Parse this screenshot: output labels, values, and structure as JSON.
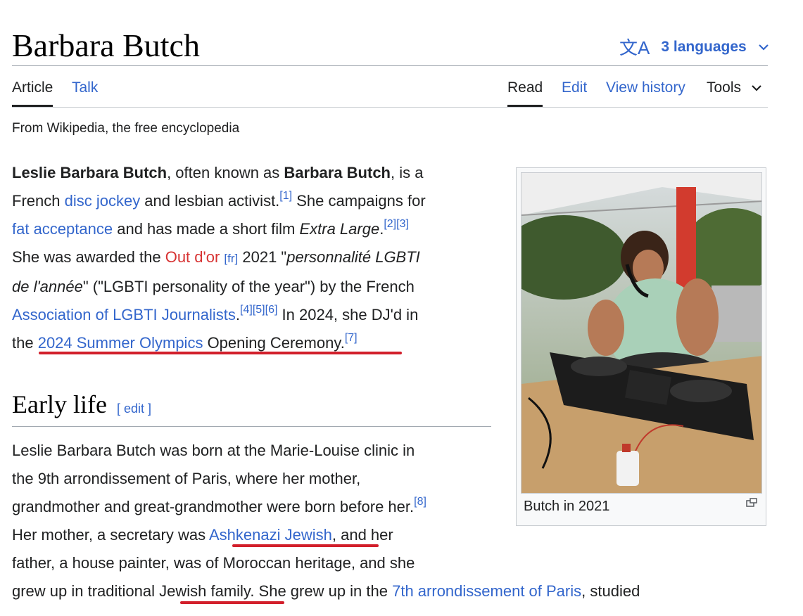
{
  "page": {
    "title": "Barbara Butch",
    "languages": "3 languages",
    "tagline": "From Wikipedia, the free encyclopedia"
  },
  "tabs": {
    "article": "Article",
    "talk": "Talk",
    "read": "Read",
    "edit": "Edit",
    "history": "View history",
    "tools": "Tools"
  },
  "intro": {
    "l1a": "Leslie Barbara Butch",
    "l1b": ", often known as ",
    "l1c": "Barbara Butch",
    "l1d": ", is a",
    "l2a": "French ",
    "l2link": "disc jockey",
    "l2b": " and lesbian activist.",
    "l2sup": "[1]",
    "l2c": " She campaigns for",
    "l3link": "fat acceptance",
    "l3a": " and has made a short film ",
    "l3i": "Extra Large",
    "l3b": ".",
    "l3sup": "[2][3]",
    "l4a": "She was awarded the ",
    "l4red": "Out d'or",
    "l4fr": "[fr]",
    "l4b": " 2021 \"",
    "l4i": "personnalité LGBTI",
    "l5i": "de l'année",
    "l5a": "\" (\"LGBTI personality of the year\") by the French",
    "l6link": "Association of LGBTI Journalists",
    "l6a": ".",
    "l6sup": "[4][5][6]",
    "l6b": " In 2024, she DJ'd in",
    "l7a": "the ",
    "l7link": "2024 Summer Olympics",
    "l7b": " Opening Ceremony.",
    "l7sup": "[7]"
  },
  "section": {
    "heading": "Early life",
    "edit": "[ edit ]"
  },
  "early": {
    "l1": "Leslie Barbara Butch was born at the Marie-Louise clinic in",
    "l2": "the 9th arrondissement of Paris, where her mother,",
    "l3": "grandmother and great-grandmother were born before her.",
    "l3sup": "[8]",
    "l4a": "Her mother, a secretary was ",
    "l4link": "Ashkenazi Jewish",
    "l4b": ", and her",
    "l5": "father, a house painter, was of Moroccan heritage, and she",
    "l6a": "grew up in traditional ",
    "l6u": "Jewish family",
    "l6b": ". She grew up in the ",
    "l6link": "7th arrondissement of Paris",
    "l6c": ", studied"
  },
  "infobox": {
    "caption": "Butch in 2021"
  },
  "colors": {
    "link": "#3366cc",
    "redlink": "#d73333",
    "annotation": "#d21f2b"
  }
}
